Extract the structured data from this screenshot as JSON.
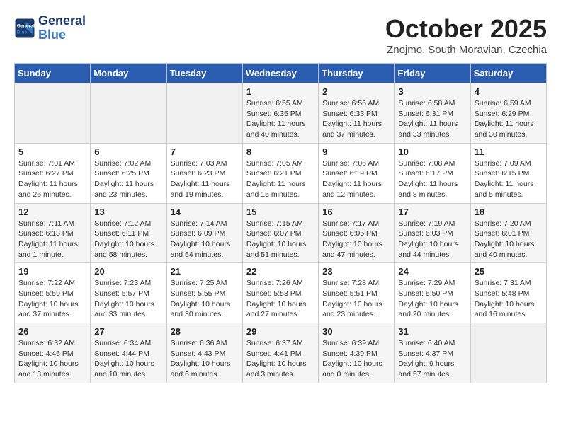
{
  "header": {
    "logo_line1": "General",
    "logo_line2": "Blue",
    "month": "October 2025",
    "location": "Znojmo, South Moravian, Czechia"
  },
  "days_of_week": [
    "Sunday",
    "Monday",
    "Tuesday",
    "Wednesday",
    "Thursday",
    "Friday",
    "Saturday"
  ],
  "weeks": [
    [
      {
        "day": "",
        "info": ""
      },
      {
        "day": "",
        "info": ""
      },
      {
        "day": "",
        "info": ""
      },
      {
        "day": "1",
        "info": "Sunrise: 6:55 AM\nSunset: 6:35 PM\nDaylight: 11 hours\nand 40 minutes."
      },
      {
        "day": "2",
        "info": "Sunrise: 6:56 AM\nSunset: 6:33 PM\nDaylight: 11 hours\nand 37 minutes."
      },
      {
        "day": "3",
        "info": "Sunrise: 6:58 AM\nSunset: 6:31 PM\nDaylight: 11 hours\nand 33 minutes."
      },
      {
        "day": "4",
        "info": "Sunrise: 6:59 AM\nSunset: 6:29 PM\nDaylight: 11 hours\nand 30 minutes."
      }
    ],
    [
      {
        "day": "5",
        "info": "Sunrise: 7:01 AM\nSunset: 6:27 PM\nDaylight: 11 hours\nand 26 minutes."
      },
      {
        "day": "6",
        "info": "Sunrise: 7:02 AM\nSunset: 6:25 PM\nDaylight: 11 hours\nand 23 minutes."
      },
      {
        "day": "7",
        "info": "Sunrise: 7:03 AM\nSunset: 6:23 PM\nDaylight: 11 hours\nand 19 minutes."
      },
      {
        "day": "8",
        "info": "Sunrise: 7:05 AM\nSunset: 6:21 PM\nDaylight: 11 hours\nand 15 minutes."
      },
      {
        "day": "9",
        "info": "Sunrise: 7:06 AM\nSunset: 6:19 PM\nDaylight: 11 hours\nand 12 minutes."
      },
      {
        "day": "10",
        "info": "Sunrise: 7:08 AM\nSunset: 6:17 PM\nDaylight: 11 hours\nand 8 minutes."
      },
      {
        "day": "11",
        "info": "Sunrise: 7:09 AM\nSunset: 6:15 PM\nDaylight: 11 hours\nand 5 minutes."
      }
    ],
    [
      {
        "day": "12",
        "info": "Sunrise: 7:11 AM\nSunset: 6:13 PM\nDaylight: 11 hours\nand 1 minute."
      },
      {
        "day": "13",
        "info": "Sunrise: 7:12 AM\nSunset: 6:11 PM\nDaylight: 10 hours\nand 58 minutes."
      },
      {
        "day": "14",
        "info": "Sunrise: 7:14 AM\nSunset: 6:09 PM\nDaylight: 10 hours\nand 54 minutes."
      },
      {
        "day": "15",
        "info": "Sunrise: 7:15 AM\nSunset: 6:07 PM\nDaylight: 10 hours\nand 51 minutes."
      },
      {
        "day": "16",
        "info": "Sunrise: 7:17 AM\nSunset: 6:05 PM\nDaylight: 10 hours\nand 47 minutes."
      },
      {
        "day": "17",
        "info": "Sunrise: 7:19 AM\nSunset: 6:03 PM\nDaylight: 10 hours\nand 44 minutes."
      },
      {
        "day": "18",
        "info": "Sunrise: 7:20 AM\nSunset: 6:01 PM\nDaylight: 10 hours\nand 40 minutes."
      }
    ],
    [
      {
        "day": "19",
        "info": "Sunrise: 7:22 AM\nSunset: 5:59 PM\nDaylight: 10 hours\nand 37 minutes."
      },
      {
        "day": "20",
        "info": "Sunrise: 7:23 AM\nSunset: 5:57 PM\nDaylight: 10 hours\nand 33 minutes."
      },
      {
        "day": "21",
        "info": "Sunrise: 7:25 AM\nSunset: 5:55 PM\nDaylight: 10 hours\nand 30 minutes."
      },
      {
        "day": "22",
        "info": "Sunrise: 7:26 AM\nSunset: 5:53 PM\nDaylight: 10 hours\nand 27 minutes."
      },
      {
        "day": "23",
        "info": "Sunrise: 7:28 AM\nSunset: 5:51 PM\nDaylight: 10 hours\nand 23 minutes."
      },
      {
        "day": "24",
        "info": "Sunrise: 7:29 AM\nSunset: 5:50 PM\nDaylight: 10 hours\nand 20 minutes."
      },
      {
        "day": "25",
        "info": "Sunrise: 7:31 AM\nSunset: 5:48 PM\nDaylight: 10 hours\nand 16 minutes."
      }
    ],
    [
      {
        "day": "26",
        "info": "Sunrise: 6:32 AM\nSunset: 4:46 PM\nDaylight: 10 hours\nand 13 minutes."
      },
      {
        "day": "27",
        "info": "Sunrise: 6:34 AM\nSunset: 4:44 PM\nDaylight: 10 hours\nand 10 minutes."
      },
      {
        "day": "28",
        "info": "Sunrise: 6:36 AM\nSunset: 4:43 PM\nDaylight: 10 hours\nand 6 minutes."
      },
      {
        "day": "29",
        "info": "Sunrise: 6:37 AM\nSunset: 4:41 PM\nDaylight: 10 hours\nand 3 minutes."
      },
      {
        "day": "30",
        "info": "Sunrise: 6:39 AM\nSunset: 4:39 PM\nDaylight: 10 hours\nand 0 minutes."
      },
      {
        "day": "31",
        "info": "Sunrise: 6:40 AM\nSunset: 4:37 PM\nDaylight: 9 hours\nand 57 minutes."
      },
      {
        "day": "",
        "info": ""
      }
    ]
  ]
}
